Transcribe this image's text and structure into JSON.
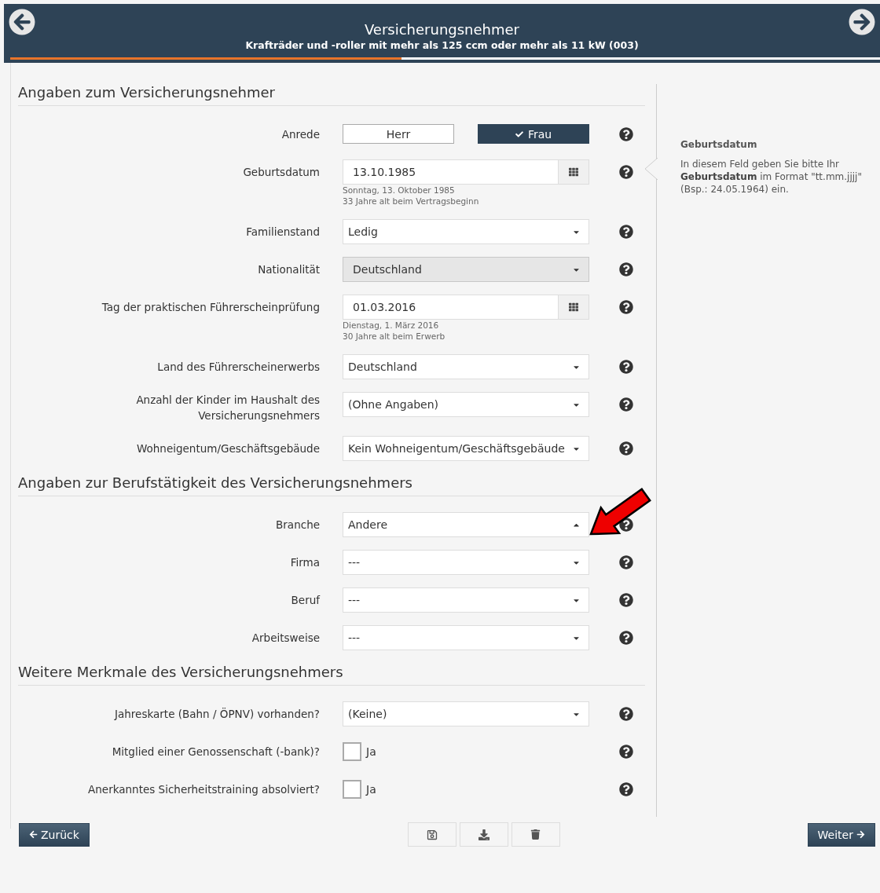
{
  "header": {
    "title": "Versicherungsnehmer",
    "subtitle": "Krafträder und -roller mit mehr als 125 ccm oder mehr als 11 kW (003)",
    "progress": {
      "level": 0.45
    }
  },
  "sections": [
    {
      "title": "Angaben zum Versicherungsnehmer",
      "fields": [
        {
          "kind": "toggle",
          "label": "Anrede",
          "options": [
            {
              "label": "Herr",
              "selected": false
            },
            {
              "label": "Frau",
              "selected": true
            }
          ]
        },
        {
          "kind": "date",
          "label": "Geburtsdatum",
          "value": "13.10.1985",
          "notes": [
            "Sonntag, 13. Oktober 1985",
            "33 Jahre alt beim Vertragsbeginn"
          ]
        },
        {
          "kind": "select",
          "label": "Familienstand",
          "value": "Ledig",
          "disabled": false,
          "expanded": false
        },
        {
          "kind": "select",
          "label": "Nationalität",
          "value": "Deutschland",
          "disabled": true,
          "expanded": false
        },
        {
          "kind": "date",
          "label": "Tag der praktischen Führerscheinprüfung",
          "value": "01.03.2016",
          "notes": [
            "Dienstag, 1. März 2016",
            "30 Jahre alt beim Erwerb"
          ]
        },
        {
          "kind": "select",
          "label": "Land des Führerscheinerwerbs",
          "value": "Deutschland",
          "disabled": false,
          "expanded": false
        },
        {
          "kind": "select",
          "label": "Anzahl der Kinder im Haushalt des Versicherungsnehmers",
          "value": "(Ohne Angaben)",
          "disabled": false,
          "expanded": false
        },
        {
          "kind": "select",
          "label": "Wohneigentum/Geschäftsgebäude",
          "value": "Kein Wohneigentum/Geschäftsgebäude",
          "disabled": false,
          "expanded": false
        }
      ]
    },
    {
      "title": "Angaben zur Berufstätigkeit des Versicherungsnehmers",
      "fields": [
        {
          "kind": "select",
          "label": "Branche",
          "value": "Andere",
          "disabled": false,
          "expanded": true
        },
        {
          "kind": "select",
          "label": "Firma",
          "value": "---",
          "disabled": false,
          "expanded": false
        },
        {
          "kind": "select",
          "label": "Beruf",
          "value": "---",
          "disabled": false,
          "expanded": false
        },
        {
          "kind": "select",
          "label": "Arbeitsweise",
          "value": "---",
          "disabled": false,
          "expanded": false
        }
      ]
    },
    {
      "title": "Weitere Merkmale des Versicherungsnehmers",
      "fields": [
        {
          "kind": "select",
          "label": "Jahreskarte (Bahn / ÖPNV) vorhanden?",
          "value": "(Keine)",
          "disabled": false,
          "expanded": false
        },
        {
          "kind": "checkbox",
          "label": "Mitglied einer Genossenschaft (-bank)?",
          "option": "Ja",
          "checked": false
        },
        {
          "kind": "checkbox",
          "label": "Anerkanntes Sicherheitstraining absolviert?",
          "option": "Ja",
          "checked": false
        }
      ]
    }
  ],
  "help_panel": {
    "title": "Geburtsdatum",
    "text": "In diesem Feld geben Sie bitte Ihr **Geburtsdatum** im Format \"tt.mm.jjjj\" (Bsp.: 24.05.1964) ein."
  },
  "footer": {
    "back": "Zurück",
    "next": "Weiter"
  }
}
